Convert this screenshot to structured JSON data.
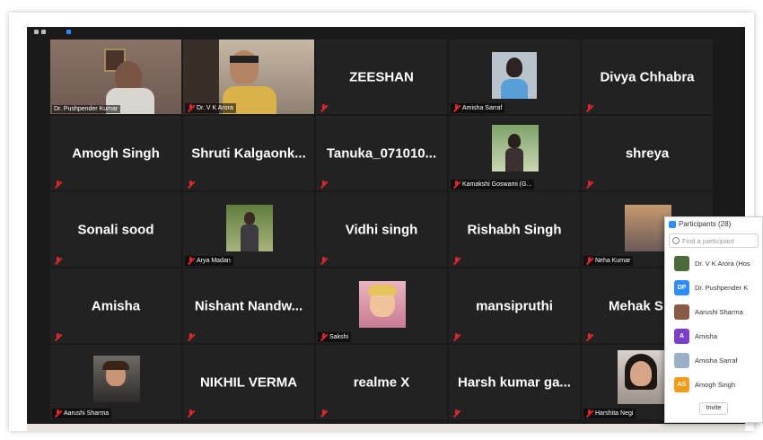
{
  "tiles": [
    {
      "name": "",
      "label": "Dr. Pushpender Kumar",
      "type": "video"
    },
    {
      "name": "",
      "label": "Dr. V K Arora",
      "type": "video"
    },
    {
      "name": "ZEESHAN",
      "label": "",
      "type": "name"
    },
    {
      "name": "",
      "label": "Amisha Sarraf",
      "type": "photo"
    },
    {
      "name": "Divya Chhabra",
      "label": "",
      "type": "name"
    },
    {
      "name": "Amogh Singh",
      "label": "",
      "type": "name"
    },
    {
      "name": "Shruti Kalgaonk...",
      "label": "",
      "type": "name"
    },
    {
      "name": "Tanuka_071010...",
      "label": "",
      "type": "name"
    },
    {
      "name": "",
      "label": "Kamakshi Goswami (G...",
      "type": "photo"
    },
    {
      "name": "shreya",
      "label": "",
      "type": "name"
    },
    {
      "name": "Sonali sood",
      "label": "",
      "type": "name"
    },
    {
      "name": "",
      "label": "Arya Madan",
      "type": "photo"
    },
    {
      "name": "Vidhi singh",
      "label": "",
      "type": "name"
    },
    {
      "name": "Rishabh Singh",
      "label": "",
      "type": "name"
    },
    {
      "name": "",
      "label": "Neha Kumar",
      "type": "photo"
    },
    {
      "name": "Amisha",
      "label": "",
      "type": "name"
    },
    {
      "name": "Nishant Nandw...",
      "label": "",
      "type": "name"
    },
    {
      "name": "",
      "label": "Sakshi",
      "type": "photo"
    },
    {
      "name": "mansipruthi",
      "label": "",
      "type": "name"
    },
    {
      "name": "Mehak S",
      "label": "",
      "type": "name"
    },
    {
      "name": "",
      "label": "Aarushi Sharma",
      "type": "photo"
    },
    {
      "name": "NIKHIL VERMA",
      "label": "",
      "type": "name"
    },
    {
      "name": "realme X",
      "label": "",
      "type": "name"
    },
    {
      "name": "Harsh kumar ga...",
      "label": "",
      "type": "name"
    },
    {
      "name": "",
      "label": "Harshita Negi",
      "type": "photo"
    }
  ],
  "panel": {
    "title": "Participants (28)",
    "search_placeholder": "Find a participant",
    "participants": [
      {
        "name": "Dr. V K Arora (Hos",
        "initials": "",
        "color": "#4a6b3a"
      },
      {
        "name": "Dr. Pushpender K",
        "initials": "DP",
        "color": "#2d8cff"
      },
      {
        "name": "Aarushi Sharma",
        "initials": "",
        "color": "#8a5a44"
      },
      {
        "name": "Amisha",
        "initials": "A",
        "color": "#7b3fc9"
      },
      {
        "name": "Amisha Sarraf",
        "initials": "",
        "color": "#9ab0c8"
      },
      {
        "name": "Amogh Singh",
        "initials": "AS",
        "color": "#f29a1a"
      }
    ],
    "invite_label": "Invite"
  },
  "colors": {
    "accent": "#2d8cff",
    "mute": "#e0262c",
    "active_border": "#c8d94a"
  }
}
